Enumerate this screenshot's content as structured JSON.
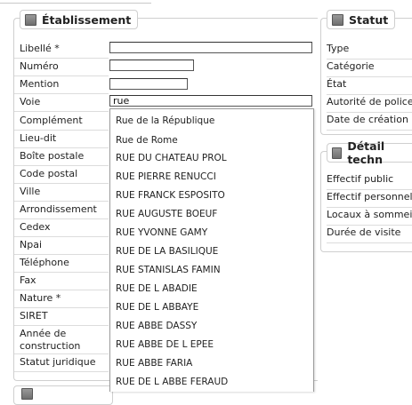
{
  "etablissement": {
    "legend": "Établissement",
    "fields": [
      {
        "label": "Libellé *",
        "value": ""
      },
      {
        "label": "Numéro",
        "value": ""
      },
      {
        "label": "Mention",
        "value": ""
      },
      {
        "label": "Voie",
        "value": "rue"
      },
      {
        "label": "Complément"
      },
      {
        "label": "Lieu-dit"
      },
      {
        "label": "Boîte postale"
      },
      {
        "label": "Code postal"
      },
      {
        "label": "Ville"
      },
      {
        "label": "Arrondissement"
      },
      {
        "label": "Cedex"
      },
      {
        "label": "Npai"
      },
      {
        "label": "Téléphone"
      },
      {
        "label": "Fax"
      },
      {
        "label": "Nature *"
      },
      {
        "label": "SIRET"
      },
      {
        "label": "Année de construction"
      },
      {
        "label": "Statut juridique"
      }
    ]
  },
  "statut": {
    "legend": "Statut",
    "rows": [
      "Type",
      "Catégorie",
      "État",
      "Autorité de police",
      "Date de création"
    ]
  },
  "detail": {
    "legend": "Détail techn",
    "rows": [
      "Effectif public",
      "Effectif personnel",
      "Locaux à sommeil",
      "Durée de visite"
    ]
  },
  "autocomplete": {
    "options": [
      "Rue de la République",
      "Rue de Rome",
      "RUE DU CHATEAU PROL",
      "RUE PIERRE RENUCCI",
      "RUE FRANCK ESPOSITO",
      "RUE AUGUSTE BOEUF",
      "RUE YVONNE GAMY",
      "RUE DE LA BASILIQUE",
      "RUE STANISLAS FAMIN",
      "RUE DE L ABADIE",
      "RUE DE L ABBAYE",
      "RUE ABBE DASSY",
      "RUE ABBE DE L EPEE",
      "RUE ABBE FARIA",
      "RUE DE L ABBE FERAUD"
    ]
  }
}
